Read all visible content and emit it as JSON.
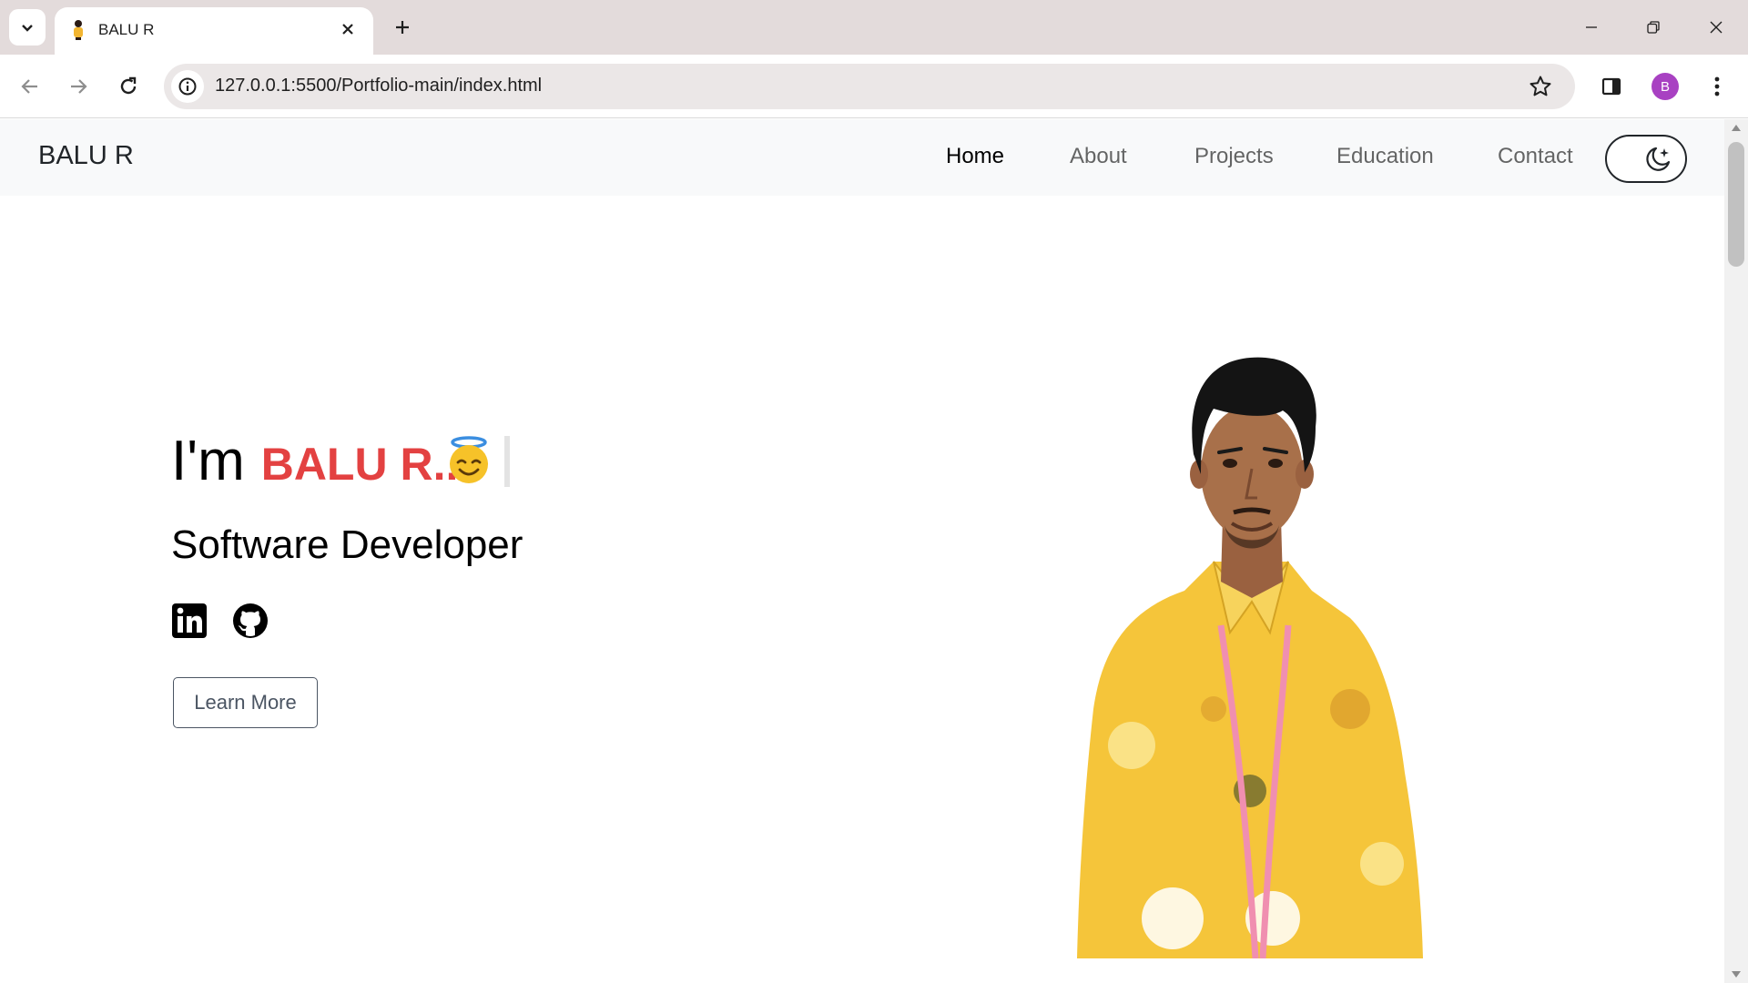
{
  "browser": {
    "tab": {
      "title": "BALU R",
      "favicon": "person-favicon"
    },
    "address_bar": {
      "url": "127.0.0.1:5500/Portfolio-main/index.html"
    },
    "profile": {
      "initial": "B",
      "color": "#a841c2"
    },
    "icons": [
      "tab-list-icon",
      "close-icon",
      "plus-icon",
      "minimize-icon",
      "restore-icon",
      "window-close-icon",
      "back-arrow-icon",
      "forward-arrow-icon",
      "reload-icon",
      "info-icon",
      "star-icon",
      "side-panel-icon",
      "more-vert-icon"
    ]
  },
  "site": {
    "brand": "BALU R",
    "nav": {
      "home": "Home",
      "about": "About",
      "projects": "Projects",
      "education": "Education",
      "contact": "Contact"
    },
    "theme_toggle_icon": "moon-stars-icon",
    "hero": {
      "greeting": "I'm",
      "name": "BALU R..",
      "emoji": "smiling-face-with-halo",
      "role": "Software Developer",
      "social": [
        "linkedin-icon",
        "github-icon"
      ],
      "cta": "Learn More"
    },
    "colors": {
      "accent": "#e34141",
      "nav_bg": "#f8f9fa",
      "shirt": "#f5c53a"
    }
  }
}
